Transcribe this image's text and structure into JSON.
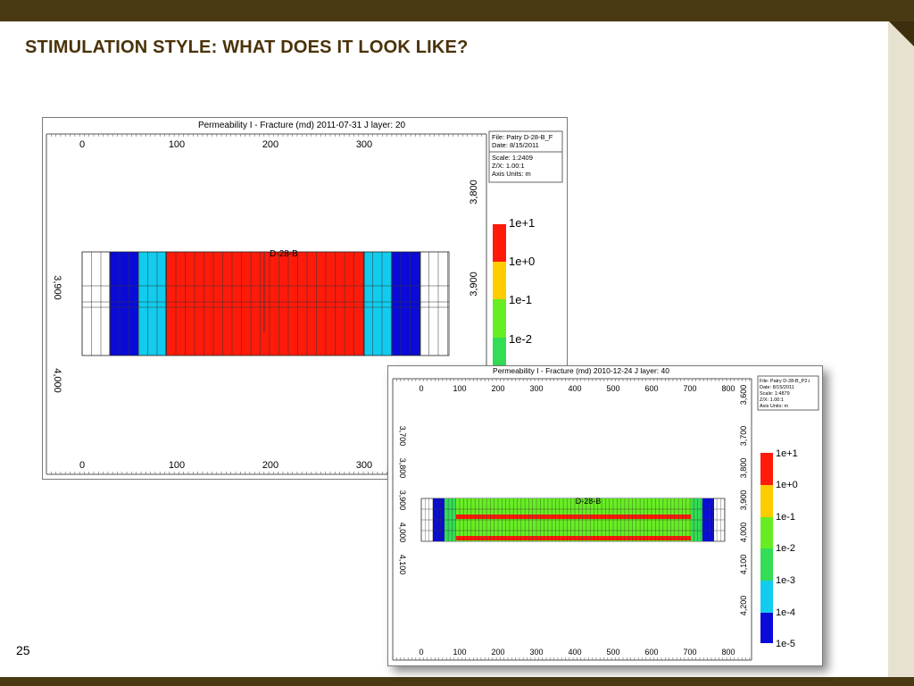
{
  "slide": {
    "title": "STIMULATION STYLE: WHAT DOES IT LOOK LIKE?",
    "page_number": "25"
  },
  "plot1": {
    "title": "Permeability I - Fracture (md) 2011-07-31     J layer: 20",
    "info": [
      "File: Patry D-28-B_F",
      "Date: 8/15/2011",
      "Scale: 1:2409",
      "Z/X: 1.00:1",
      "Axis Units: m"
    ],
    "x_ticks": [
      "0",
      "100",
      "200",
      "300"
    ],
    "y_ticks_left": [
      "3,900",
      "4,000"
    ],
    "y_ticks_right": [
      "3,800",
      "3,900"
    ],
    "well_label": "D-28-B",
    "legend": [
      "1e+1",
      "1e+0",
      "1e-1",
      "1e-2"
    ]
  },
  "plot2": {
    "title": "Permeability I - Fracture (md) 2010-12-24     J layer: 40",
    "info": [
      "File: Patry D-28-B_P2.i",
      "Date: 8/15/2011",
      "Scale: 1:4879",
      "Z/X: 1.00:1",
      "Axis Units: m"
    ],
    "x_ticks": [
      "0",
      "100",
      "200",
      "300",
      "400",
      "500",
      "600",
      "700",
      "800"
    ],
    "y_ticks_left": [
      "3,700",
      "3,800",
      "3,900",
      "4,000",
      "4,100"
    ],
    "y_ticks_right": [
      "3,600",
      "3,700",
      "3,800",
      "3,900",
      "4,000",
      "4,100",
      "4,200"
    ],
    "well_label": "D-28-B",
    "legend": [
      "1e+1",
      "1e+0",
      "1e-1",
      "1e-2",
      "1e-3",
      "1e-4",
      "1e-5"
    ]
  },
  "colors": {
    "red": "#ff1a0a",
    "orange": "#ffcc00",
    "green": "#66ee22",
    "green_dark": "#33dd55",
    "cyan": "#11ccee",
    "blue": "#0a0ad8",
    "frame_brown": "#4a3a14"
  }
}
